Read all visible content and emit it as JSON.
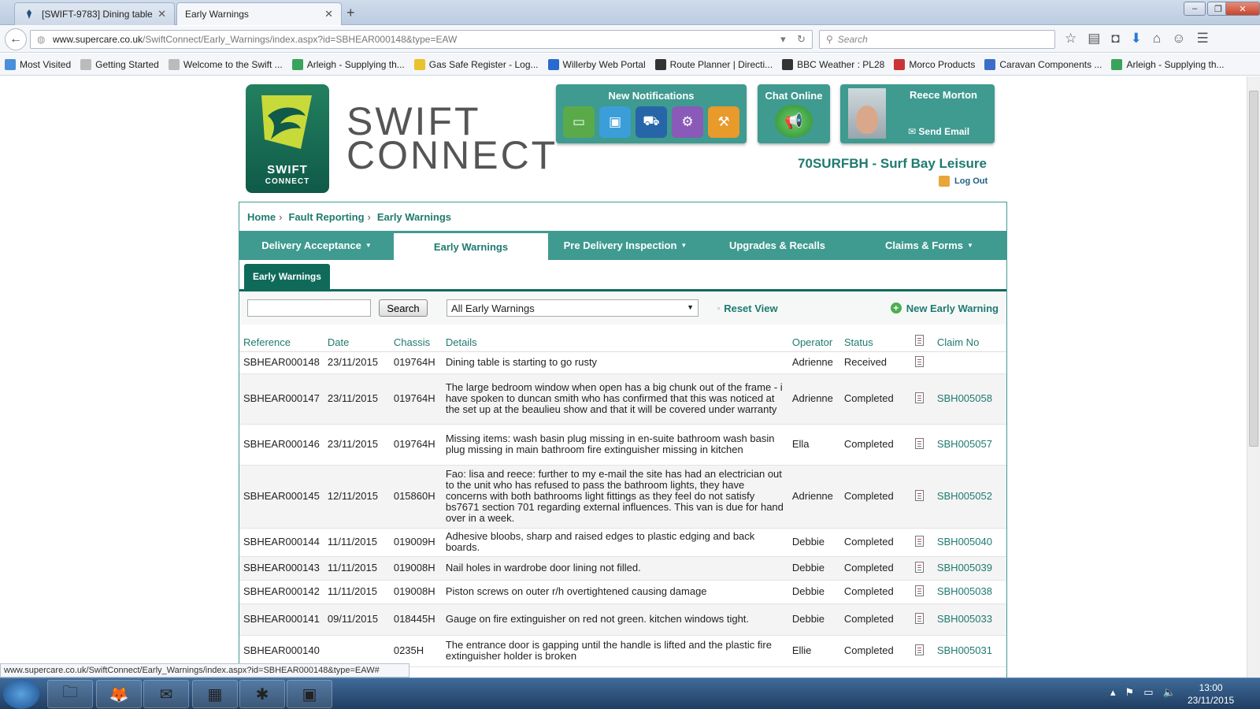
{
  "browser": {
    "tabs": [
      {
        "label": "[SWIFT-9783] Dining table l...",
        "icon": "jira-icon"
      },
      {
        "label": "Early Warnings",
        "icon": ""
      }
    ],
    "url_domain": "www.supercare.co.uk",
    "url_path": "/SwiftConnect/Early_Warnings/index.aspx?id=SBHEAR000148&type=EAW",
    "search_placeholder": "Search",
    "bookmarks": [
      "Most Visited",
      "Getting Started",
      "Welcome to the Swift ...",
      "Arleigh - Supplying th...",
      "Gas Safe Register - Log...",
      "Willerby Web Portal",
      "Route Planner | Directi...",
      "BBC Weather : PL28",
      "Morco Products",
      "Caravan Components ...",
      "Arleigh - Supplying th..."
    ],
    "status_url": "www.supercare.co.uk/SwiftConnect/Early_Warnings/index.aspx?id=SBHEAR000148&type=EAW#"
  },
  "header": {
    "logo_text_1": "SWIFT",
    "logo_text_2": "CONNECT",
    "wordmark_1": "SWIFT",
    "wordmark_2": "CONNECT",
    "notifications_title": "New Notifications",
    "chat_title": "Chat Online",
    "user_name": "Reece Morton",
    "send_email": "Send Email",
    "dealer": "70SURFBH - Surf Bay Leisure",
    "logout": "Log Out"
  },
  "breadcrumb": [
    "Home",
    "Fault Reporting",
    "Early Warnings"
  ],
  "nav": [
    {
      "label": "Delivery Acceptance",
      "caret": true,
      "active": false
    },
    {
      "label": "Early Warnings",
      "caret": false,
      "active": true
    },
    {
      "label": "Pre Delivery Inspection",
      "caret": true,
      "active": false
    },
    {
      "label": "Upgrades & Recalls",
      "caret": false,
      "active": false
    },
    {
      "label": "Claims & Forms",
      "caret": true,
      "active": false
    }
  ],
  "subtab": "Early Warnings",
  "toolbar": {
    "search_value": "",
    "search_button": "Search",
    "filter_selected": "All Early Warnings",
    "reset_view": "Reset View",
    "new_warning": "New Early Warning"
  },
  "table": {
    "columns": [
      "Reference",
      "Date",
      "Chassis",
      "Details",
      "Operator",
      "Status",
      "",
      "Claim No"
    ],
    "rows": [
      {
        "ref": "SBHEAR000148",
        "date": "23/11/2015",
        "chassis": "019764H",
        "details": "Dining table is starting to go rusty",
        "operator": "Adrienne",
        "status": "Received",
        "claim": ""
      },
      {
        "ref": "SBHEAR000147",
        "date": "23/11/2015",
        "chassis": "019764H",
        "details": "The large bedroom window when open has a big chunk out of the frame - i have spoken to duncan smith who has confirmed that this was noticed at the set up at the beaulieu show and that it will be covered under warranty",
        "operator": "Adrienne",
        "status": "Completed",
        "claim": "SBH005058"
      },
      {
        "ref": "SBHEAR000146",
        "date": "23/11/2015",
        "chassis": "019764H",
        "details": "Missing items: wash basin plug missing in en-suite bathroom wash basin plug missing in main bathroom fire extinguisher missing in kitchen",
        "operator": "Ella",
        "status": "Completed",
        "claim": "SBH005057"
      },
      {
        "ref": "SBHEAR000145",
        "date": "12/11/2015",
        "chassis": "015860H",
        "details": "Fao: lisa and reece: further to my e-mail the site has had an electrician out to the unit who has refused to pass the bathroom lights, they have concerns with both bathrooms light fittings as they feel do not satisfy bs7671 section 701 regarding external influences. This van is due for hand over in a week.",
        "operator": "Adrienne",
        "status": "Completed",
        "claim": "SBH005052"
      },
      {
        "ref": "SBHEAR000144",
        "date": "11/11/2015",
        "chassis": "019009H",
        "details": "Adhesive bloobs, sharp and raised edges to plastic edging and back boards.",
        "operator": "Debbie",
        "status": "Completed",
        "claim": "SBH005040"
      },
      {
        "ref": "SBHEAR000143",
        "date": "11/11/2015",
        "chassis": "019008H",
        "details": "Nail holes in wardrobe door lining not filled.",
        "operator": "Debbie",
        "status": "Completed",
        "claim": "SBH005039"
      },
      {
        "ref": "SBHEAR000142",
        "date": "11/11/2015",
        "chassis": "019008H",
        "details": "Piston screws on outer r/h overtightened causing damage",
        "operator": "Debbie",
        "status": "Completed",
        "claim": "SBH005038"
      },
      {
        "ref": "SBHEAR000141",
        "date": "09/11/2015",
        "chassis": "018445H",
        "details": "Gauge on fire extinguisher on red not green. kitchen windows tight.",
        "operator": "Debbie",
        "status": "Completed",
        "claim": "SBH005033"
      },
      {
        "ref": "SBHEAR000140",
        "date": "",
        "chassis": "0235H",
        "details": "The entrance door is gapping until the handle is lifted and the plastic fire extinguisher holder is broken",
        "operator": "Ellie",
        "status": "Completed",
        "claim": "SBH005031"
      }
    ]
  },
  "taskbar": {
    "time": "13:00",
    "date": "23/11/2015"
  },
  "colors": {
    "teal": "#3f9a90",
    "dark_teal": "#0f6a5a",
    "link": "#1f7a70"
  }
}
